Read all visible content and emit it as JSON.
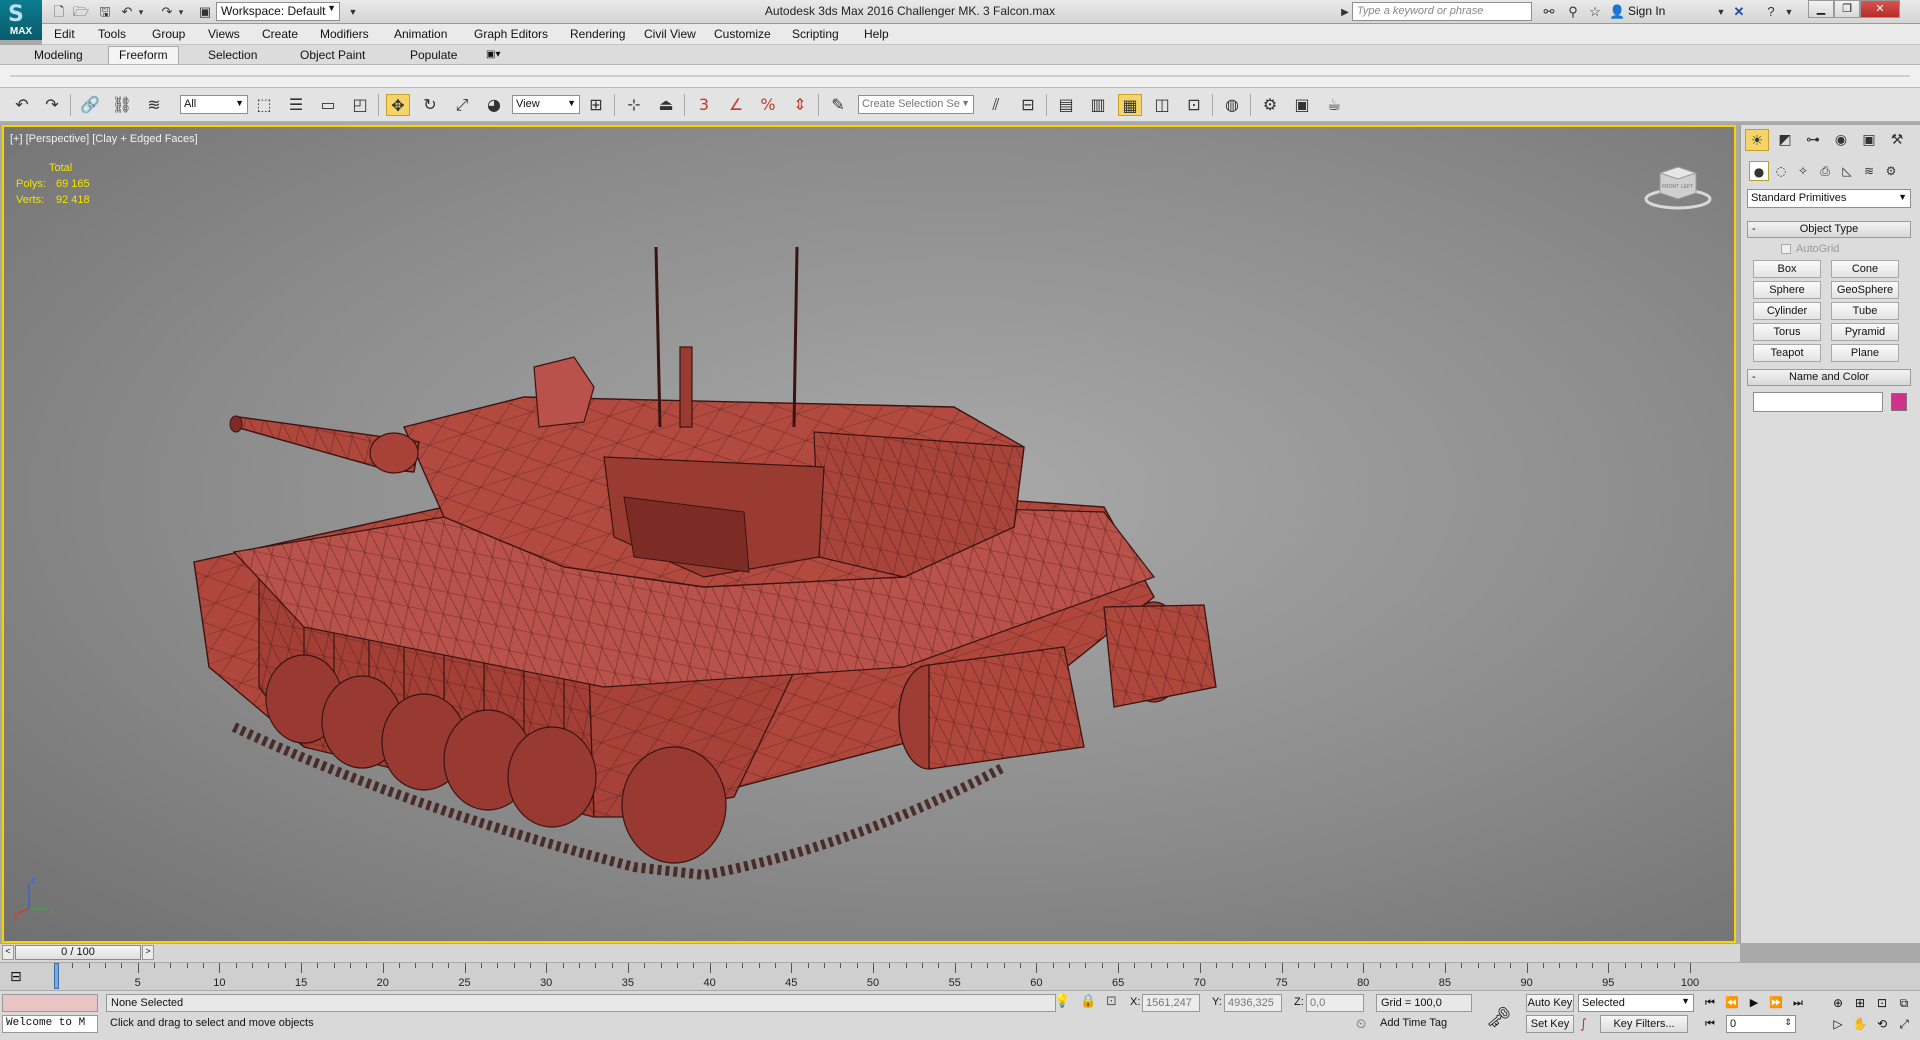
{
  "app": {
    "logo_text": "MAX",
    "window_title": "Autodesk 3ds Max 2016     Challenger MK. 3 Falcon.max",
    "workspace_label": "Workspace: Default",
    "search_placeholder": "Type a keyword or phrase",
    "sign_in": "Sign In"
  },
  "menu": [
    "Edit",
    "Tools",
    "Group",
    "Views",
    "Create",
    "Modifiers",
    "Animation",
    "Graph Editors",
    "Rendering",
    "Civil View",
    "Customize",
    "Scripting",
    "Help"
  ],
  "ribbon_tabs": [
    "Modeling",
    "Freeform",
    "Selection",
    "Object Paint",
    "Populate"
  ],
  "ribbon_active": "Freeform",
  "toolbar": {
    "filter_value": "All",
    "ref_coord": "View",
    "selection_set_placeholder": "Create Selection Se",
    "snap_labels": [
      "3",
      "%"
    ]
  },
  "viewport": {
    "label": "[+] [Perspective] [Clay + Edged Faces]",
    "stats_title": "Total",
    "polys_label": "Polys:",
    "polys_value": "69 165",
    "verts_label": "Verts:",
    "verts_value": "92 418",
    "viewcube_front": "FRONT",
    "viewcube_left": "LEFT",
    "axis_x": "x",
    "axis_y": "y",
    "axis_z": "z"
  },
  "command_panel": {
    "category": "Standard Primitives",
    "object_type_title": "Object Type",
    "autogrid": "AutoGrid",
    "primitives": [
      "Box",
      "Cone",
      "Sphere",
      "GeoSphere",
      "Cylinder",
      "Tube",
      "Torus",
      "Pyramid",
      "Teapot",
      "Plane"
    ],
    "name_color_title": "Name and Color",
    "color": "#d1318a"
  },
  "timeline": {
    "frame_display": "0 / 100",
    "ticks": [
      5,
      10,
      15,
      20,
      25,
      30,
      35,
      40,
      45,
      50,
      55,
      60,
      65,
      70,
      75,
      80,
      85,
      90,
      95,
      100
    ]
  },
  "status": {
    "maxscript_text": "Welcome to M",
    "selection": "None Selected",
    "prompt": "Click and drag to select and move objects",
    "x_label": "X:",
    "x_value": "1561,247",
    "y_label": "Y:",
    "y_value": "4936,325",
    "z_label": "Z:",
    "z_value": "0,0",
    "grid": "Grid = 100,0",
    "add_time_tag": "Add Time Tag",
    "auto_key": "Auto Key",
    "set_key": "Set Key",
    "selected_drop": "Selected",
    "key_filters": "Key Filters...",
    "frame": "0"
  },
  "colors": {
    "viewport_border": "#f5d400",
    "stats_text": "#f2e400",
    "tank_fill": "#b0473c",
    "wire": "#3a1410",
    "active_tool": "#f5d56a"
  }
}
